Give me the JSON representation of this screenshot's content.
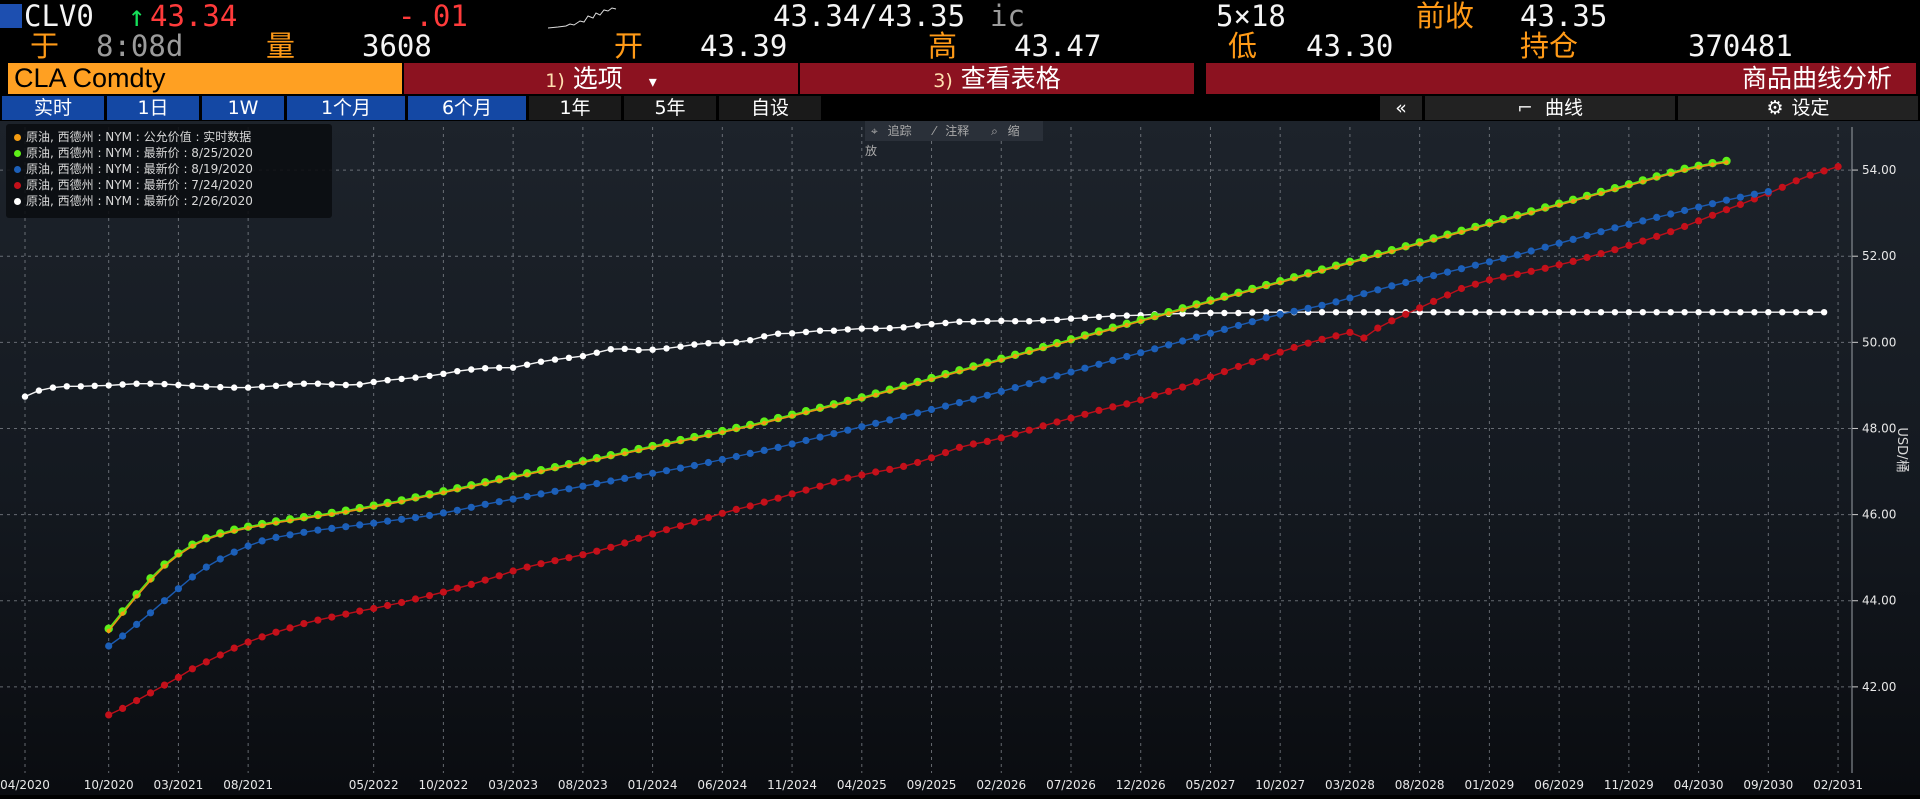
{
  "header": {
    "ticker": "CLV0",
    "arrow": "↑",
    "last": "43.34",
    "change": "-.01",
    "bid_ask": "43.34/43.35",
    "bid_ask_suffix": "ic",
    "size": "5×18",
    "prev_close_label": "前收",
    "prev_close": "43.35",
    "time_label": "于",
    "time": "8:08d",
    "volume_label": "量",
    "volume": "3608",
    "open_label": "开",
    "open": "43.39",
    "high_label": "高",
    "high": "43.47",
    "low_label": "低",
    "low": "43.30",
    "oi_label": "持仓",
    "oi": "370481"
  },
  "toolbar": {
    "security": "CLA Comdty",
    "options_num": "1)",
    "options_label": "选项",
    "options_arrow": "▾",
    "table_num": "3)",
    "table_label": "查看表格",
    "analysis_label": "商品曲线分析"
  },
  "tabs": {
    "items": [
      "实时",
      "1日",
      "1W",
      "1个月",
      "6个月",
      "1年",
      "5年",
      "自设"
    ],
    "collapse": "«",
    "curve_label": "曲线",
    "settings_label": "设定"
  },
  "chart_tools": [
    "追踪",
    "注释",
    "缩放"
  ],
  "legend": [
    "原油, 西德州 : NYM : 公允价值 : 实时数据",
    "原油, 西德州 : NYM : 最新价 : 8/25/2020",
    "原油, 西德州 : NYM : 最新价 : 8/19/2020",
    "原油, 西德州 : NYM : 最新价 : 7/24/2020",
    "原油, 西德州 : NYM : 最新价 : 2/26/2020"
  ],
  "colors": {
    "accent_orange": "#ff9a17",
    "green_series": "#5ef018",
    "blue_series": "#1c5fb8",
    "red_series": "#c4101a",
    "white_series": "#ffffff",
    "fair_value": "#f39c12"
  },
  "chart_data": {
    "type": "line",
    "ylabel": "USD/桶",
    "ylim": [
      40.0,
      55.0
    ],
    "y_ticks": [
      "42.00",
      "44.00",
      "46.00",
      "48.00",
      "50.00",
      "52.00",
      "54.00"
    ],
    "y_tick_values": [
      42,
      44,
      46,
      48,
      50,
      52,
      54
    ],
    "x_tick_labels": [
      "04/2020",
      "10/2020",
      "03/2021",
      "08/2021",
      "05/2022",
      "10/2022",
      "03/2023",
      "08/2023",
      "01/2024",
      "06/2024",
      "11/2024",
      "04/2025",
      "09/2025",
      "02/2026",
      "07/2026",
      "12/2026",
      "05/2027",
      "10/2027",
      "03/2028",
      "08/2028",
      "01/2029",
      "06/2029",
      "11/2029",
      "04/2030",
      "09/2030",
      "02/2031"
    ],
    "x_tick_months": [
      0,
      6,
      11,
      16,
      25,
      30,
      35,
      40,
      45,
      50,
      55,
      60,
      65,
      70,
      75,
      80,
      85,
      90,
      95,
      100,
      105,
      110,
      115,
      120,
      125,
      130
    ],
    "x_range_months": [
      0,
      131
    ],
    "series": [
      {
        "name": "原油, 西德州 : NYM : 最新价 : 2/26/2020",
        "start_month": 0,
        "values": [
          48.74,
          48.88,
          48.95,
          48.98,
          48.98,
          48.99,
          49.0,
          49.02,
          49.04,
          49.04,
          49.03,
          49.01,
          48.99,
          48.97,
          48.96,
          48.95,
          48.95,
          48.97,
          48.99,
          49.02,
          49.04,
          49.04,
          49.02,
          49.01,
          49.02,
          49.08,
          49.12,
          49.15,
          49.18,
          49.22,
          49.27,
          49.33,
          49.37,
          49.4,
          49.41,
          49.41,
          49.48,
          49.55,
          49.6,
          49.64,
          49.68,
          49.76,
          49.84,
          49.85,
          49.82,
          49.83,
          49.86,
          49.9,
          49.95,
          49.98,
          49.99,
          50.0,
          50.05,
          50.14,
          50.2,
          50.21,
          50.24,
          50.27,
          50.27,
          50.3,
          50.32,
          50.32,
          50.33,
          50.35,
          50.39,
          50.42,
          50.45,
          50.48,
          50.48,
          50.49,
          50.5,
          50.49,
          50.49,
          50.51,
          50.52,
          50.55,
          50.57,
          50.59,
          50.61,
          50.62,
          50.63,
          50.65,
          50.66,
          50.67,
          50.67,
          50.68,
          50.68,
          50.68,
          50.69,
          50.7,
          50.7,
          50.7,
          50.7,
          50.7,
          50.7,
          50.7,
          50.7,
          50.7,
          50.7,
          50.7,
          50.7,
          50.7,
          50.7,
          50.7,
          50.7,
          50.7,
          50.7,
          50.7,
          50.7,
          50.7,
          50.7,
          50.7,
          50.7,
          50.7,
          50.7,
          50.7,
          50.7,
          50.7,
          50.7,
          50.7,
          50.7,
          50.7,
          50.7,
          50.7,
          50.7,
          50.7,
          50.7,
          50.7,
          50.7,
          50.7
        ]
      },
      {
        "name": "原油, 西德州 : NYM : 最新价 : 7/24/2020",
        "start_month": 6,
        "values": [
          41.35,
          41.5,
          41.68,
          41.86,
          42.04,
          42.22,
          42.42,
          42.58,
          42.74,
          42.9,
          43.04,
          43.16,
          43.27,
          43.37,
          43.47,
          43.55,
          43.62,
          43.69,
          43.76,
          43.82,
          43.89,
          43.96,
          44.04,
          44.12,
          44.2,
          44.29,
          44.38,
          44.48,
          44.58,
          44.69,
          44.78,
          44.86,
          44.93,
          45.0,
          45.07,
          45.15,
          45.24,
          45.34,
          45.45,
          45.55,
          45.65,
          45.74,
          45.83,
          45.93,
          46.03,
          46.12,
          46.2,
          46.29,
          46.38,
          46.48,
          46.57,
          46.66,
          46.76,
          46.85,
          46.92,
          46.99,
          47.05,
          47.12,
          47.21,
          47.32,
          47.44,
          47.56,
          47.64,
          47.7,
          47.78,
          47.87,
          47.96,
          48.06,
          48.15,
          48.24,
          48.33,
          48.42,
          48.5,
          48.57,
          48.66,
          48.77,
          48.86,
          48.96,
          49.08,
          49.2,
          49.32,
          49.44,
          49.55,
          49.66,
          49.77,
          49.88,
          49.98,
          50.07,
          50.15,
          50.23,
          50.1,
          50.33,
          50.5,
          50.65,
          50.8,
          50.95,
          51.1,
          51.25,
          51.35,
          51.45,
          51.52,
          51.58,
          51.65,
          51.72,
          51.8,
          51.88,
          51.97,
          52.06,
          52.15,
          52.25,
          52.35,
          52.46,
          52.57,
          52.69,
          52.82,
          52.95,
          53.08,
          53.2,
          53.33,
          53.46,
          53.6,
          53.75,
          53.88,
          53.98,
          54.08
        ]
      },
      {
        "name": "原油, 西德州 : NYM : 最新价 : 8/19/2020",
        "start_month": 6,
        "values": [
          42.95,
          43.18,
          43.45,
          43.72,
          44.0,
          44.28,
          44.55,
          44.78,
          44.97,
          45.13,
          45.27,
          45.39,
          45.47,
          45.53,
          45.59,
          45.64,
          45.68,
          45.72,
          45.76,
          45.8,
          45.85,
          45.89,
          45.93,
          45.98,
          46.04,
          46.1,
          46.17,
          46.24,
          46.3,
          46.36,
          46.42,
          46.48,
          46.54,
          46.6,
          46.66,
          46.72,
          46.78,
          46.84,
          46.9,
          46.96,
          47.02,
          47.08,
          47.14,
          47.21,
          47.28,
          47.35,
          47.42,
          47.49,
          47.56,
          47.64,
          47.72,
          47.8,
          47.88,
          47.96,
          48.04,
          48.12,
          48.2,
          48.28,
          48.36,
          48.44,
          48.52,
          48.6,
          48.68,
          48.77,
          48.86,
          48.95,
          49.04,
          49.13,
          49.22,
          49.31,
          49.4,
          49.49,
          49.58,
          49.67,
          49.76,
          49.85,
          49.94,
          50.03,
          50.12,
          50.21,
          50.3,
          50.39,
          50.48,
          50.57,
          50.65,
          50.72,
          50.79,
          50.86,
          50.94,
          51.03,
          51.13,
          51.22,
          51.31,
          51.39,
          51.47,
          51.55,
          51.63,
          51.71,
          51.79,
          51.87,
          51.95,
          52.03,
          52.12,
          52.21,
          52.3,
          52.39,
          52.48,
          52.57,
          52.66,
          52.74,
          52.82,
          52.9,
          52.98,
          53.06,
          53.14,
          53.22,
          53.3,
          53.37,
          53.44,
          53.5
        ]
      },
      {
        "name": "原油, 西德州 : NYM : 最新价 : 8/25/2020",
        "start_month": 6,
        "values": [
          43.35,
          43.75,
          44.15,
          44.52,
          44.84,
          45.1,
          45.3,
          45.45,
          45.56,
          45.65,
          45.72,
          45.78,
          45.84,
          45.89,
          45.94,
          45.99,
          46.04,
          46.09,
          46.15,
          46.21,
          46.27,
          46.33,
          46.4,
          46.47,
          46.54,
          46.61,
          46.68,
          46.75,
          46.82,
          46.89,
          46.96,
          47.03,
          47.1,
          47.17,
          47.24,
          47.31,
          47.38,
          47.45,
          47.52,
          47.59,
          47.66,
          47.73,
          47.8,
          47.87,
          47.94,
          48.01,
          48.08,
          48.16,
          48.24,
          48.32,
          48.4,
          48.48,
          48.56,
          48.64,
          48.72,
          48.81,
          48.9,
          48.99,
          49.08,
          49.17,
          49.26,
          49.35,
          49.44,
          49.53,
          49.62,
          49.71,
          49.8,
          49.89,
          49.98,
          50.07,
          50.16,
          50.25,
          50.34,
          50.43,
          50.52,
          50.61,
          50.7,
          50.79,
          50.88,
          50.97,
          51.06,
          51.15,
          51.24,
          51.33,
          51.42,
          51.51,
          51.6,
          51.69,
          51.78,
          51.87,
          51.96,
          52.05,
          52.14,
          52.23,
          52.32,
          52.41,
          52.5,
          52.59,
          52.68,
          52.77,
          52.86,
          52.95,
          53.04,
          53.13,
          53.22,
          53.31,
          53.4,
          53.49,
          53.58,
          53.67,
          53.76,
          53.85,
          53.94,
          54.03,
          54.1,
          54.16,
          54.21
        ]
      },
      {
        "name": "原油, 西德州 : NYM : 公允价值 : 实时数据",
        "start_month": 6,
        "values": [
          43.3,
          43.7,
          44.1,
          44.47,
          44.8,
          45.06,
          45.27,
          45.42,
          45.53,
          45.62,
          45.69,
          45.75,
          45.81,
          45.86,
          45.91,
          45.96,
          46.01,
          46.06,
          46.12,
          46.18,
          46.24,
          46.3,
          46.37,
          46.44,
          46.51,
          46.58,
          46.65,
          46.72,
          46.79,
          46.86,
          46.93,
          47.0,
          47.07,
          47.14,
          47.21,
          47.28,
          47.35,
          47.42,
          47.49,
          47.56,
          47.63,
          47.7,
          47.77,
          47.84,
          47.91,
          47.98,
          48.05,
          48.13,
          48.21,
          48.29,
          48.37,
          48.45,
          48.53,
          48.61,
          48.69,
          48.78,
          48.87,
          48.96,
          49.05,
          49.14,
          49.23,
          49.32,
          49.41,
          49.5,
          49.59,
          49.68,
          49.77,
          49.86,
          49.95,
          50.04,
          50.13,
          50.22,
          50.31,
          50.4,
          50.49,
          50.58,
          50.67,
          50.76,
          50.85,
          50.94,
          51.03,
          51.12,
          51.21,
          51.3,
          51.39,
          51.48,
          51.57,
          51.66,
          51.75,
          51.84,
          51.93,
          52.02,
          52.11,
          52.2,
          52.29,
          52.38,
          52.47,
          52.56,
          52.65,
          52.74,
          52.83,
          52.92,
          53.01,
          53.1,
          53.19,
          53.28,
          53.37,
          53.46,
          53.55,
          53.64,
          53.73,
          53.82,
          53.91,
          54.0,
          54.07,
          54.13,
          54.18
        ]
      }
    ]
  }
}
